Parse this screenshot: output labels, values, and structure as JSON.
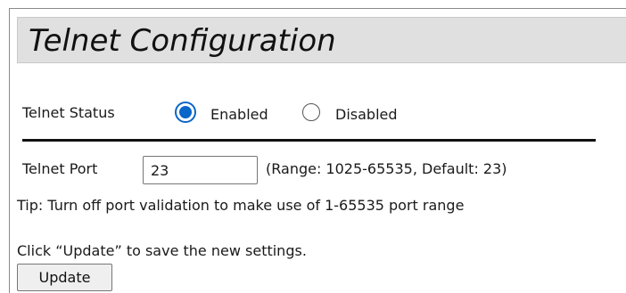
{
  "page": {
    "title": "Telnet Configuration"
  },
  "status": {
    "label": "Telnet Status",
    "options": [
      {
        "label": "Enabled",
        "selected": true
      },
      {
        "label": "Disabled",
        "selected": false
      }
    ]
  },
  "port": {
    "label": "Telnet Port",
    "value": "23",
    "range_text": "(Range: 1025-65535, Default: 23)"
  },
  "tip": "Tip: Turn off port validation to make use of 1-65535 port range",
  "footer": {
    "instruction": "Click “Update” to save the new settings.",
    "update_label": "Update"
  },
  "colors": {
    "accent": "#0a66c8",
    "title_bar_bg": "#e0e0e0"
  }
}
